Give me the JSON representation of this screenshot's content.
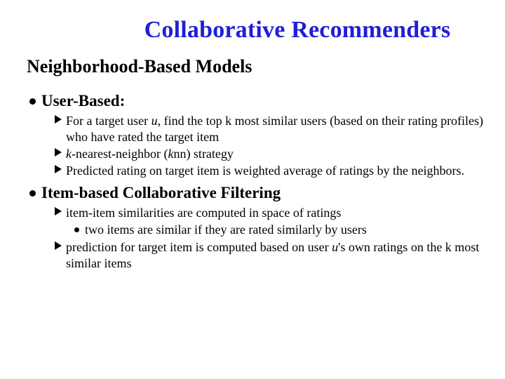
{
  "title": "Collaborative Recommenders",
  "subtitle": "Neighborhood-Based Models",
  "sections": [
    {
      "heading": "User-Based:",
      "points": [
        {
          "pre": "For a target user ",
          "em": "u",
          "post": ", find the top k most similar users (based on their rating profiles) who have rated the target item"
        },
        {
          "em0": "k",
          "mid": "-nearest-neighbor (",
          "em1": "k",
          "post": "nn) strategy"
        },
        {
          "pre": "Predicted rating on target item is weighted average of ratings by the neighbors."
        }
      ]
    },
    {
      "heading": "Item-based Collaborative Filtering",
      "points": [
        {
          "pre": "item-item similarities are computed in space of ratings",
          "sub": "two items are similar if they are rated similarly by users"
        },
        {
          "pre": "prediction for target item is computed based on user ",
          "em": "u",
          "post": "'s own ratings on the k most similar items"
        }
      ]
    }
  ]
}
